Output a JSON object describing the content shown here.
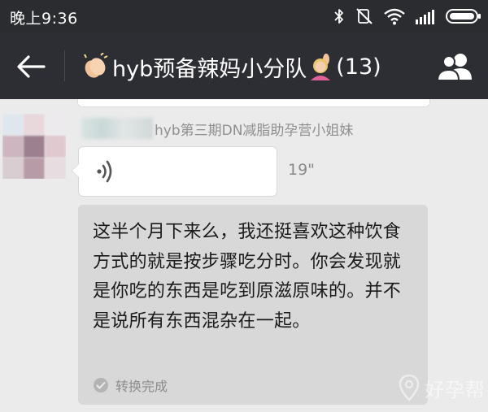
{
  "status_bar": {
    "time": "晚上9:36",
    "icons": [
      "bluetooth-icon",
      "mute-icon",
      "wifi-icon",
      "signal-icon",
      "battery-icon"
    ]
  },
  "header": {
    "title": "hyb预备辣妈小分队",
    "member_count": "(13)",
    "title_emoji_left": "clapping-hands-icon",
    "title_emoji_right": "raising-hand-woman-icon",
    "back_icon": "back-arrow-icon",
    "members_icon": "group-members-icon"
  },
  "message": {
    "sender": "hyb第三期DN减脂助孕营小姐妹",
    "voice_duration": "19\"",
    "transcript": "这半个月下来么，我还挺喜欢这种饮食方式的就是按步骤吃分时。你会发现就是你吃的东西是吃到原滋原味的。并不是说所有东西混杂在一起。",
    "transcript_status": "转换完成"
  },
  "watermark": {
    "text": "好孕帮"
  },
  "colors": {
    "header_bg": "#2d2e33",
    "status_bar_bg": "#2b2c30",
    "chat_bg": "#ebebeb",
    "transcript_bg": "#d8d8d8",
    "bubble_bg": "#ffffff"
  }
}
